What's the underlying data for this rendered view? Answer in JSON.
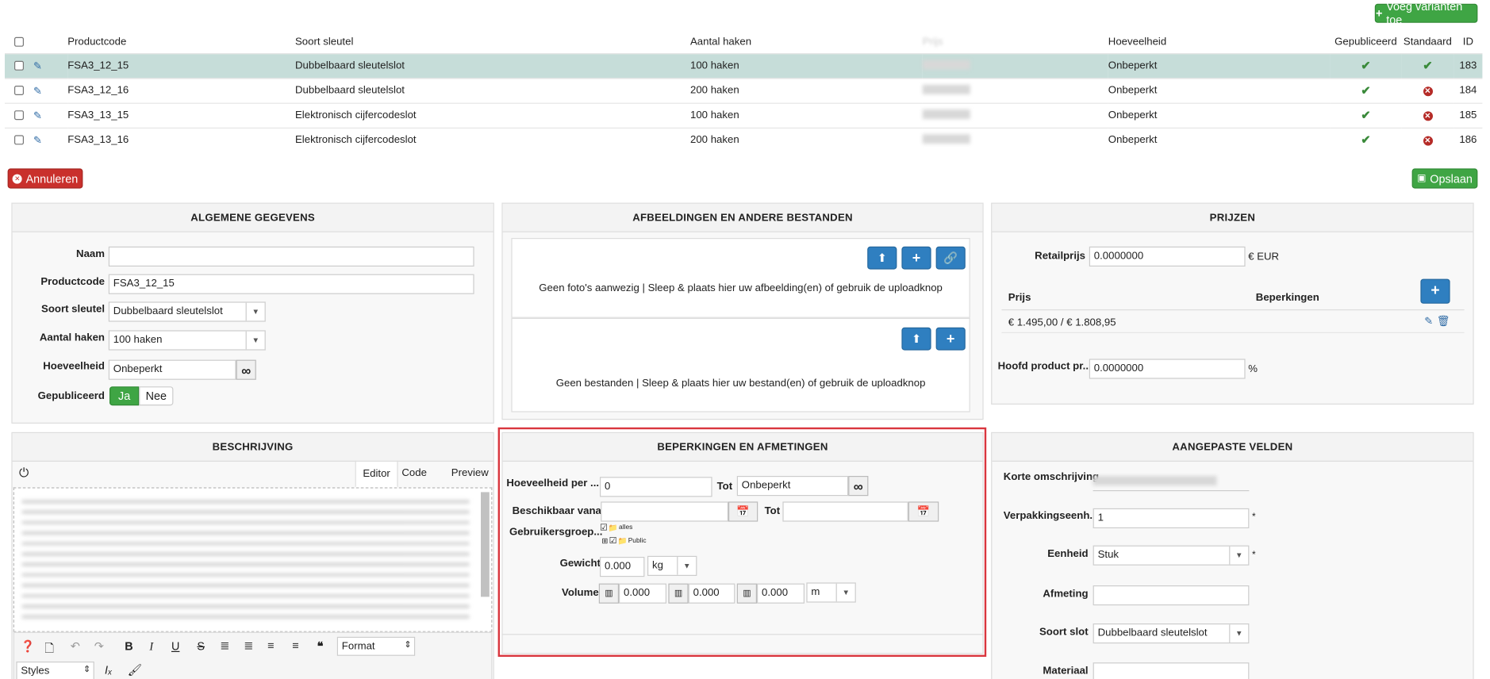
{
  "toolbar": {
    "add_variants": "Voeg varianten toe",
    "cancel": "Annuleren",
    "save": "Opslaan"
  },
  "variants": {
    "headers": [
      "Productcode",
      "Soort sleutel",
      "Aantal haken",
      "Prijs",
      "Hoeveelheid",
      "Gepubliceerd",
      "Standaard",
      "ID"
    ],
    "rows": [
      {
        "code": "FSA3_12_15",
        "type": "Dubbelbaard sleutelslot",
        "hooks": "100 haken",
        "qty": "Onbeperkt",
        "published": true,
        "standard": true,
        "id": "183"
      },
      {
        "code": "FSA3_12_16",
        "type": "Dubbelbaard sleutelslot",
        "hooks": "200 haken",
        "qty": "Onbeperkt",
        "published": true,
        "standard": false,
        "id": "184"
      },
      {
        "code": "FSA3_13_15",
        "type": "Elektronisch cijfercodeslot",
        "hooks": "100 haken",
        "qty": "Onbeperkt",
        "published": true,
        "standard": false,
        "id": "185"
      },
      {
        "code": "FSA3_13_16",
        "type": "Elektronisch cijfercodeslot",
        "hooks": "200 haken",
        "qty": "Onbeperkt",
        "published": true,
        "standard": false,
        "id": "186"
      }
    ]
  },
  "general": {
    "title": "ALGEMENE GEGEVENS",
    "name_label": "Naam",
    "name_value": "",
    "code_label": "Productcode",
    "code_value": "FSA3_12_15",
    "key_label": "Soort sleutel",
    "key_value": "Dubbelbaard sleutelslot",
    "hooks_label": "Aantal haken",
    "hooks_value": "100 haken",
    "qty_label": "Hoeveelheid",
    "qty_value": "Onbeperkt",
    "published_label": "Gepubliceerd",
    "yes": "Ja",
    "no": "Nee"
  },
  "files": {
    "title": "AFBEELDINGEN EN ANDERE BESTANDEN",
    "no_images": "Geen foto's aanwezig | Sleep & plaats hier uw afbeelding(en) of gebruik de uploadknop",
    "no_files": "Geen bestanden | Sleep & plaats hier uw bestand(en) of gebruik de uploadknop"
  },
  "prices": {
    "title": "PRIJZEN",
    "retail_label": "Retailprijs",
    "retail_value": "0.0000000",
    "currency": "€ EUR",
    "col_price": "Prijs",
    "col_restrictions": "Beperkingen",
    "price_row": "€ 1.495,00 / € 1.808,95",
    "main_label": "Hoofd product pr...",
    "main_value": "0.0000000",
    "percent": "%"
  },
  "description": {
    "title": "BESCHRIJVING",
    "tabs": [
      "Editor",
      "Code",
      "Preview"
    ],
    "format": "Format",
    "styles": "Styles"
  },
  "restrictions": {
    "title": "BEPERKINGEN EN AFMETINGEN",
    "qty_per_label": "Hoeveelheid per ...",
    "qty_per_value": "0",
    "to": "Tot",
    "to_value": "Onbeperkt",
    "available_label": "Beschikbaar vanaf",
    "groups_label": "Gebruikersgroep...",
    "group_all": "alles",
    "group_public": "Public",
    "weight_label": "Gewicht",
    "weight_value": "0.000",
    "weight_unit": "kg",
    "volume_label": "Volume",
    "volume_values": [
      "0.000",
      "0.000",
      "0.000"
    ],
    "volume_unit": "m"
  },
  "custom": {
    "title": "AANGEPASTE VELDEN",
    "short_label": "Korte omschrijving",
    "pack_label": "Verpakkingseenh...",
    "pack_value": "1",
    "unit_label": "Eenheid",
    "unit_value": "Stuk",
    "size_label": "Afmeting",
    "lock_label": "Soort slot",
    "lock_value": "Dubbelbaard sleutelslot",
    "material_label": "Materiaal",
    "required": "*"
  }
}
